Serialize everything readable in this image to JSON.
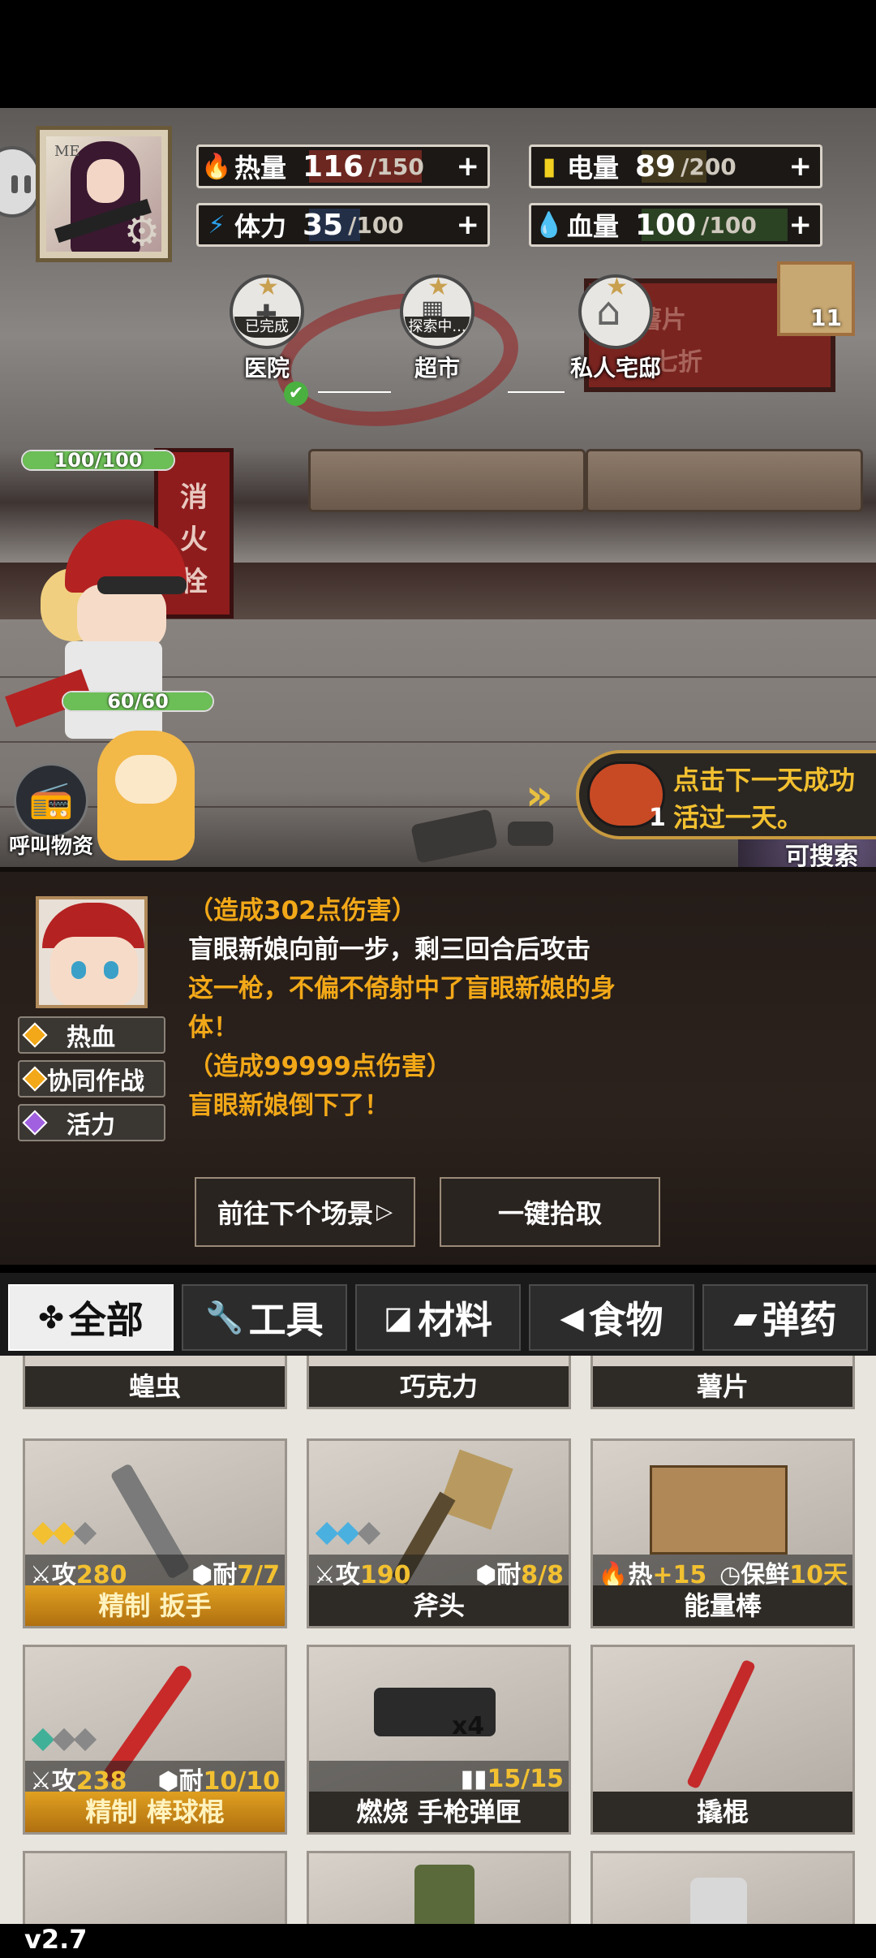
{
  "stats": {
    "heat": {
      "name": "热量",
      "value": "116",
      "max": "/150",
      "plus": "+",
      "fraction": 0.773
    },
    "power": {
      "name": "电量",
      "value": "89",
      "max": "/200",
      "plus": "+",
      "fraction": 0.445
    },
    "stamina": {
      "name": "体力",
      "value": "35",
      "max": "/100",
      "plus": "+",
      "fraction": 0.35
    },
    "health": {
      "name": "血量",
      "value": "100",
      "max": "/100",
      "plus": "+",
      "fraction": 1.0
    }
  },
  "avatar": {
    "me_label": "ME"
  },
  "locations": [
    {
      "name": "医院",
      "tag": "已完成"
    },
    {
      "name": "超市",
      "tag": "探索中..."
    },
    {
      "name": "私人宅邸",
      "tag": ""
    }
  ],
  "envelope_count": "11",
  "hydrant_text": [
    "消",
    "火",
    "栓"
  ],
  "poster_text": [
    "薯片",
    "七折"
  ],
  "character": {
    "hp": "100/100",
    "hp_fraction": 1.0
  },
  "pet": {
    "hp": "60/60",
    "hp_fraction": 1.0
  },
  "call_supplies": "呼叫物资",
  "tip": {
    "count": "1",
    "line1": "点击下一天成功",
    "line2": "活过一天。"
  },
  "can_search": "可搜索",
  "traits": [
    {
      "label": "热血",
      "color": "#f2a818"
    },
    {
      "label": "协同作战",
      "color": "#f2a818"
    },
    {
      "label": "活力",
      "color": "#a060e0"
    }
  ],
  "battle_log": [
    {
      "text": "（造成302点伤害）",
      "style": "gold"
    },
    {
      "text": "盲眼新娘向前一步，剩三回合后攻击",
      "style": "white"
    },
    {
      "text": "这一枪，不偏不倚射中了盲眼新娘的身",
      "style": "gold"
    },
    {
      "text": "体！",
      "style": "gold"
    },
    {
      "text": "（造成99999点伤害）",
      "style": "gold"
    },
    {
      "text": "盲眼新娘倒下了！",
      "style": "gold"
    }
  ],
  "buttons": {
    "next_scene": "前往下个场景",
    "pickup_all": "一键拾取"
  },
  "tabs": [
    {
      "label": "全部",
      "icon": "✤"
    },
    {
      "label": "工具",
      "icon": "🔧"
    },
    {
      "label": "材料",
      "icon": "◪"
    },
    {
      "label": "食物",
      "icon": "◀"
    },
    {
      "label": "弹药",
      "icon": "▰"
    }
  ],
  "items_top_row": [
    {
      "name": "蝗虫"
    },
    {
      "name": "巧克力"
    },
    {
      "name": "薯片"
    }
  ],
  "items": [
    {
      "name": "精制 扳手",
      "refined": true,
      "stat1_label": "⚔攻",
      "stat1": "280",
      "stat2_label": "⬢耐",
      "stat2": "7/7",
      "stars": [
        "#f2c030",
        "#f2c030",
        "#888"
      ]
    },
    {
      "name": "斧头",
      "refined": false,
      "stat1_label": "⚔攻",
      "stat1": "190",
      "stat2_label": "⬢耐",
      "stat2": "8/8",
      "stars": [
        "#4ab0e0",
        "#4ab0e0",
        "#888"
      ]
    },
    {
      "name": "能量棒",
      "refined": false,
      "stat1_label": "🔥热",
      "stat1": "+15",
      "stat2_label": "◷保鲜",
      "stat2": "10天",
      "stars": []
    },
    {
      "name": "精制 棒球棍",
      "refined": true,
      "stat1_label": "⚔攻",
      "stat1": "238",
      "stat2_label": "⬢耐",
      "stat2": "10/10",
      "stars": [
        "#40b098",
        "#888",
        "#888"
      ]
    },
    {
      "name": "燃烧 手枪弹匣",
      "refined": false,
      "stat1_label": "",
      "stat1": "",
      "stat2_label": "▮▮",
      "stat2": "15/15",
      "stars": [],
      "qty": "x4"
    },
    {
      "name": "撬棍",
      "refined": false,
      "stat1_label": "",
      "stat1": "",
      "stat2_label": "",
      "stat2": "",
      "stars": []
    }
  ],
  "version": "v2.7"
}
